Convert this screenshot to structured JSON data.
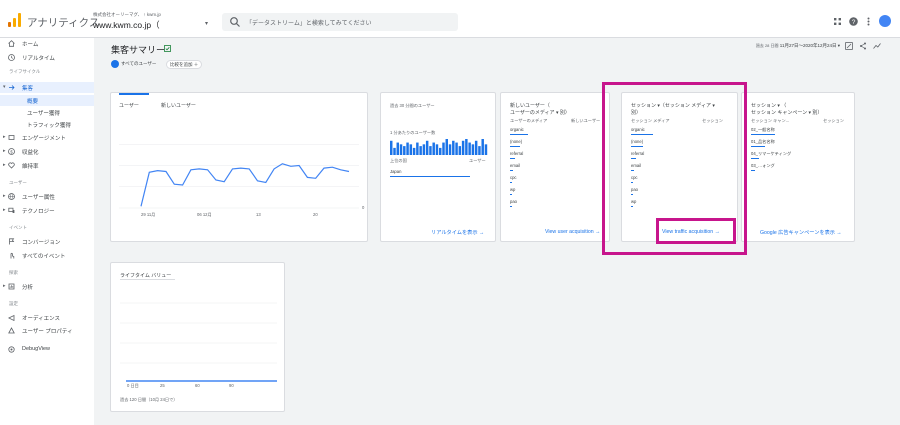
{
  "topbar": {
    "app_name": "アナリティクス",
    "account_sub": "株式会社オーリーマグ、 ↑ kwm.jp",
    "account_main": "www.kwm.co.jp（",
    "caret": "▾",
    "search_placeholder": "「データストリーム」と検索してみてください"
  },
  "sidebar": {
    "items": [
      {
        "label": "ホーム",
        "icon": "home-icon",
        "arrow": ""
      },
      {
        "label": "リアルタイム",
        "icon": "clock-icon",
        "arrow": ""
      },
      {
        "label": "集客",
        "icon": "acquisition-icon",
        "arrow": "▾"
      },
      {
        "label": "概要",
        "sub": true
      },
      {
        "label": "ユーザー獲得",
        "sub": true
      },
      {
        "label": "トラフィック獲得",
        "sub": true
      },
      {
        "label": "エンゲージメント",
        "icon": "engagement-icon",
        "arrow": "▸"
      },
      {
        "label": "収益化",
        "icon": "monetization-icon",
        "arrow": "▸"
      },
      {
        "label": "維持率",
        "icon": "retention-icon",
        "arrow": "▸"
      },
      {
        "label": "ユーザー属性",
        "icon": "globe-icon",
        "arrow": "▸"
      },
      {
        "label": "テクノロジー",
        "icon": "devices-icon",
        "arrow": "▸"
      },
      {
        "label": "コンバージョン",
        "icon": "flag-icon",
        "arrow": ""
      },
      {
        "label": "すべてのイベント",
        "icon": "touch-icon",
        "arrow": ""
      },
      {
        "label": "分析",
        "icon": "analysis-icon",
        "arrow": "▸"
      },
      {
        "label": "オーディエンス",
        "icon": "audience-icon",
        "arrow": ""
      },
      {
        "label": "ユーザー プロパティ",
        "icon": "user-property-icon",
        "arrow": ""
      },
      {
        "label": "DebugView",
        "icon": "debug-icon",
        "arrow": ""
      }
    ],
    "sections": [
      "ライフサイクル",
      "ユーザー",
      "イベント",
      "探索",
      "設定"
    ]
  },
  "header": {
    "title": "集客サマリー",
    "chip_all_users": "すべてのユーザー",
    "chip_compare": "比較を追加 ＋",
    "date_prefix": "過去 28 日間",
    "date_range": "11月27日〜2020年12月24日 ▾"
  },
  "cards": {
    "users": {
      "tab1": "ユーザー",
      "tab2": "新しいユーザー",
      "x_labels": [
        "29\n11月",
        "06\n12月",
        "13",
        "20"
      ],
      "y_zero": "0",
      "chart_data": {
        "type": "line",
        "series": [
          {
            "values": [
              0.02,
              0.42,
              0.44,
              0.43,
              0.28,
              0.27,
              0.45,
              0.46,
              0.45,
              0.33,
              0.31,
              0.46,
              0.47,
              0.46,
              0.32,
              0.3,
              0.46,
              0.52,
              0.49,
              0.5,
              0.36,
              0.35,
              0.47,
              0.48,
              0.45,
              0.43
            ]
          }
        ]
      }
    },
    "realtime": {
      "header": "過去 30 分間のユーザー",
      "sub": "1 分あたりのユーザー数",
      "col_country": "上位の国",
      "col_users": "ユーザー",
      "country": "Japan",
      "link": "リアルタイムを表示 →",
      "chart_data": {
        "type": "bar",
        "values": [
          8,
          4,
          7,
          6,
          5,
          7,
          6,
          4,
          7,
          5,
          6,
          8,
          5,
          7,
          6,
          4,
          7,
          9,
          6,
          8,
          7,
          5,
          8,
          9,
          7,
          6,
          8,
          5,
          9,
          6
        ]
      }
    },
    "new_users": {
      "title": "新しいユーザー（",
      "title2": "ユーザーのメディア ▾ 別）",
      "col1": "ユーザーのメディア",
      "col2": "新しいユーザー",
      "rows": [
        "organic",
        "(none)",
        "referral",
        "email",
        "cpc",
        "wp",
        "pao"
      ],
      "link": "View user acquisition →"
    },
    "traffic": {
      "title": "セッション ▾（セッション メディア ▾",
      "title2": "別）",
      "col1": "セッション メディア",
      "col2": "セッション",
      "rows": [
        "organic",
        "(none)",
        "referral",
        "email",
        "cpc",
        "pao",
        "wp"
      ],
      "link": "View traffic acquisition →"
    },
    "campaign": {
      "title": "セッション ▾ （",
      "title2": "セッション キャンペーン ▾ 別）",
      "col1": "セッション キャン...",
      "col2": "セッション",
      "rows": [
        "02_一般名称",
        "01_品名名称",
        "04_リマーケティング",
        "03_…ォング"
      ],
      "link": "Google 広告キャンペーンを表示 →"
    },
    "ltv": {
      "title": "ライフタイム バリュー",
      "x_labels": [
        "0\n日目",
        "25",
        "60",
        "90"
      ],
      "footer": "過去 120 日間（10月 24日で）"
    }
  },
  "colors": {
    "accent": "#1a73e8",
    "highlight": "#c7158c",
    "logo1": "#f9ab00",
    "logo2": "#e37400"
  }
}
